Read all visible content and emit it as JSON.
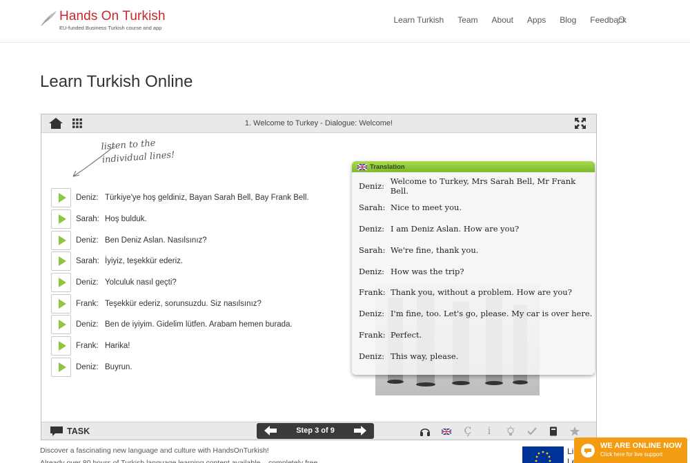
{
  "header": {
    "logo_title": "Hands On Turkish",
    "logo_subtitle": "EU-funded Business Turkish course and app",
    "nav": [
      "Learn Turkish",
      "Team",
      "About",
      "Apps",
      "Blog",
      "Feedback"
    ],
    "search_icon": "search-icon"
  },
  "page_title": "Learn Turkish Online",
  "player": {
    "lesson_title": "1. Welcome to Turkey - Dialogue: Welcome!",
    "hint_line1": "listen to the",
    "hint_line2": "individual lines!",
    "lines": [
      {
        "speaker": "Deniz:",
        "text": "Türkiye'ye hoş geldiniz, Bayan Sarah Bell, Bay Frank Bell."
      },
      {
        "speaker": "Sarah:",
        "text": "Hoş bulduk."
      },
      {
        "speaker": "Deniz:",
        "text": "Ben Deniz Aslan. Nasılsınız?"
      },
      {
        "speaker": "Sarah:",
        "text": "İyiyiz, teşekkür ederiz."
      },
      {
        "speaker": "Deniz:",
        "text": "Yolculuk nasıl geçti?"
      },
      {
        "speaker": "Frank:",
        "text": "Teşekkür ederiz, sorunsuzdu. Siz nasılsınız?"
      },
      {
        "speaker": "Deniz:",
        "text": "Ben de iyiyim. Gidelim lütfen. Arabam hemen burada."
      },
      {
        "speaker": "Frank:",
        "text": "Harika!"
      },
      {
        "speaker": "Deniz:",
        "text": "Buyrun."
      }
    ],
    "translation": {
      "title": "Translation",
      "rows": [
        {
          "speaker": "Deniz:",
          "text": "Welcome to Turkey, Mrs Sarah Bell, Mr Frank Bell."
        },
        {
          "speaker": "Sarah:",
          "text": "Nice to meet you."
        },
        {
          "speaker": "Deniz:",
          "text": "I am Deniz Aslan. How are you?"
        },
        {
          "speaker": "Sarah:",
          "text": "We're fine, thank you."
        },
        {
          "speaker": "Deniz:",
          "text": "How was the trip?"
        },
        {
          "speaker": "Frank:",
          "text": "Thank you, without a problem. How are you?"
        },
        {
          "speaker": "Deniz:",
          "text": "I'm fine, too. Let's go, please. My car is over here."
        },
        {
          "speaker": "Frank:",
          "text": "Perfect."
        },
        {
          "speaker": "Deniz:",
          "text": "This way, please."
        }
      ]
    },
    "task_label": "TASK",
    "step_label": "Step 3 of 9",
    "tool_letters": {
      "cedilla": "Ç",
      "info": "i"
    }
  },
  "footer": {
    "desc_line1": "Discover a fascinating new language and culture with HandsOnTurkish!",
    "desc_line2": "Already over 80 hours of Turkish language learning content available – completely free.",
    "eu_text_1": "Li",
    "eu_text_2": "Le"
  },
  "live_chat": {
    "title": "WE ARE ONLINE NOW",
    "subtitle": "Click here for live support"
  },
  "colors": {
    "brand_red": "#c8262d",
    "play_green": "#8dc63f",
    "chat_orange": "#f39c12"
  }
}
